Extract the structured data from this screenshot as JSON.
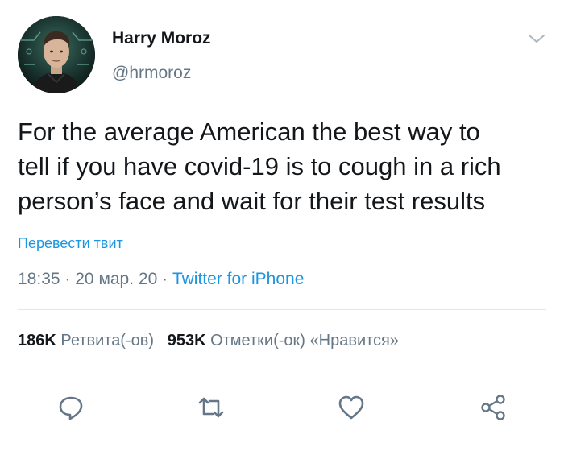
{
  "author": {
    "display_name": "Harry Moroz",
    "username": "@hrmoroz"
  },
  "tweet": {
    "lines": [
      "For the average American the best way to",
      "tell if you have covid-19 is to cough in a rich",
      "person’s face and wait for their test results"
    ],
    "translate_label": "Перевести твит",
    "time": "18:35",
    "separator": "·",
    "date": "20 мар. 20",
    "source": "Twitter for iPhone"
  },
  "stats": {
    "retweets_count": "186K",
    "retweets_label": "Ретвита(-ов)",
    "likes_count": "953K",
    "likes_label": "Отметки(-ок) «Нравится»"
  },
  "icons": {
    "menu": "chevron-down-icon",
    "reply": "reply-icon",
    "retweet": "retweet-icon",
    "like": "heart-icon",
    "share": "share-icon"
  },
  "colors": {
    "text": "#14171a",
    "secondary": "#657786",
    "link": "#1b95e0",
    "divider": "#e1e8ed"
  }
}
